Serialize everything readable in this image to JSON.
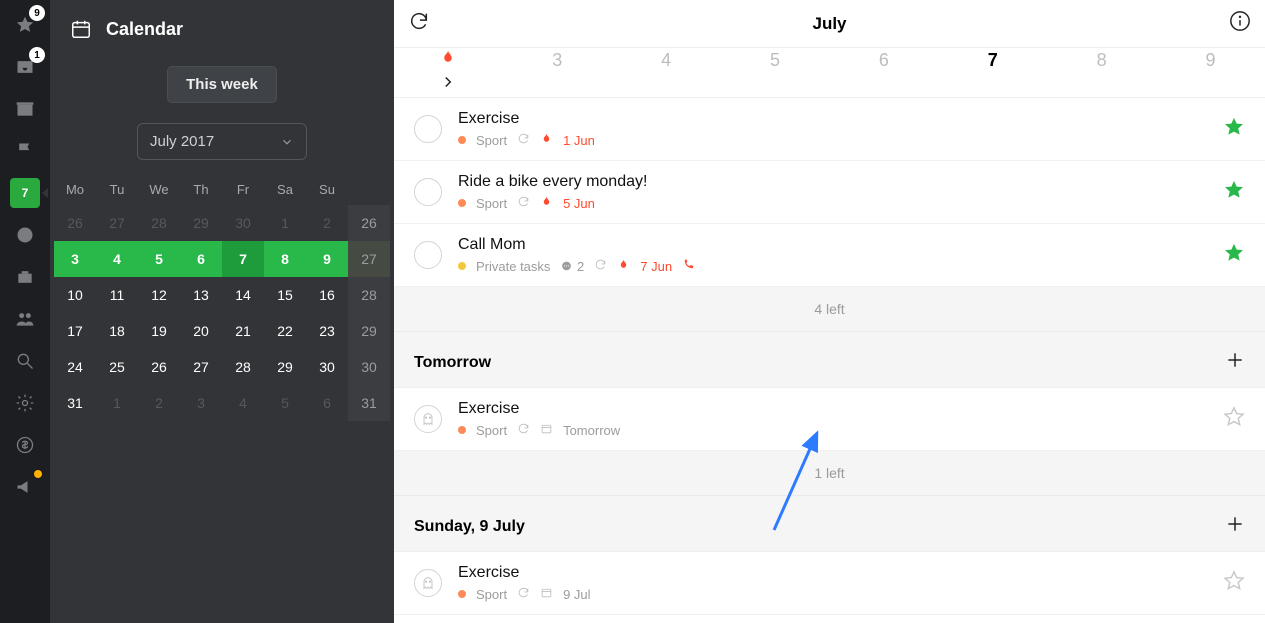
{
  "icon_badges": {
    "star": "9",
    "inbox": "1",
    "cal": "7"
  },
  "sidebar": {
    "title": "Calendar",
    "this_week": "This week",
    "month_label": "July 2017"
  },
  "cal_head": [
    "Mo",
    "Tu",
    "We",
    "Th",
    "Fr",
    "Sa",
    "Su",
    ""
  ],
  "cal_rows": [
    [
      {
        "n": "26",
        "c": "muted"
      },
      {
        "n": "27",
        "c": "muted"
      },
      {
        "n": "28",
        "c": "muted"
      },
      {
        "n": "29",
        "c": "muted"
      },
      {
        "n": "30",
        "c": "muted"
      },
      {
        "n": "1",
        "c": "muted"
      },
      {
        "n": "2",
        "c": "muted"
      },
      {
        "n": "26",
        "c": "wk"
      }
    ],
    [
      {
        "n": "3",
        "c": "green"
      },
      {
        "n": "4",
        "c": "green"
      },
      {
        "n": "5",
        "c": "green"
      },
      {
        "n": "6",
        "c": "green"
      },
      {
        "n": "7",
        "c": "today"
      },
      {
        "n": "8",
        "c": "green"
      },
      {
        "n": "9",
        "c": "green"
      },
      {
        "n": "27",
        "c": "wk green-adj"
      }
    ],
    [
      {
        "n": "10"
      },
      {
        "n": "11"
      },
      {
        "n": "12"
      },
      {
        "n": "13"
      },
      {
        "n": "14"
      },
      {
        "n": "15"
      },
      {
        "n": "16"
      },
      {
        "n": "28",
        "c": "wk"
      }
    ],
    [
      {
        "n": "17"
      },
      {
        "n": "18"
      },
      {
        "n": "19"
      },
      {
        "n": "20"
      },
      {
        "n": "21"
      },
      {
        "n": "22"
      },
      {
        "n": "23"
      },
      {
        "n": "29",
        "c": "wk"
      }
    ],
    [
      {
        "n": "24"
      },
      {
        "n": "25"
      },
      {
        "n": "26"
      },
      {
        "n": "27"
      },
      {
        "n": "28"
      },
      {
        "n": "29"
      },
      {
        "n": "30"
      },
      {
        "n": "30",
        "c": "wk"
      }
    ],
    [
      {
        "n": "31"
      },
      {
        "n": "1",
        "c": "muted"
      },
      {
        "n": "2",
        "c": "muted"
      },
      {
        "n": "3",
        "c": "muted"
      },
      {
        "n": "4",
        "c": "muted"
      },
      {
        "n": "5",
        "c": "muted"
      },
      {
        "n": "6",
        "c": "muted"
      },
      {
        "n": "31",
        "c": "wk"
      }
    ]
  ],
  "topbar": {
    "title": "July"
  },
  "daybar": [
    "fire",
    "3",
    "4",
    "5",
    "6",
    "7",
    "8",
    "9"
  ],
  "daybar_active_idx": 5,
  "tag_colors": {
    "sport": "#ff8a57",
    "private": "#f5c83b"
  },
  "sections": {
    "overdue": {
      "tasks": [
        {
          "title": "Exercise",
          "tag": "Sport",
          "tag_color": "sport",
          "repeat": true,
          "fire": true,
          "due": "1 Jun",
          "starred": true,
          "comment_count": null,
          "phone": false,
          "ghost": false,
          "due_calendar": false
        },
        {
          "title": "Ride a bike every monday!",
          "tag": "Sport",
          "tag_color": "sport",
          "repeat": true,
          "fire": true,
          "due": "5 Jun",
          "starred": true,
          "comment_count": null,
          "phone": false,
          "ghost": false,
          "due_calendar": false
        },
        {
          "title": "Call Mom",
          "tag": "Private tasks",
          "tag_color": "private",
          "repeat": true,
          "fire": true,
          "due": "7 Jun",
          "starred": true,
          "comment_count": "2",
          "phone": true,
          "ghost": false,
          "due_calendar": false
        }
      ],
      "left": "4 left"
    },
    "tomorrow": {
      "label": "Tomorrow",
      "tasks": [
        {
          "title": "Exercise",
          "tag": "Sport",
          "tag_color": "sport",
          "repeat": true,
          "fire": false,
          "due": "Tomorrow",
          "starred": false,
          "comment_count": null,
          "phone": false,
          "ghost": true,
          "due_calendar": true
        }
      ],
      "left": "1 left"
    },
    "sunday": {
      "label": "Sunday, 9 July",
      "tasks": [
        {
          "title": "Exercise",
          "tag": "Sport",
          "tag_color": "sport",
          "repeat": true,
          "fire": false,
          "due": "9 Jul",
          "starred": false,
          "comment_count": null,
          "phone": false,
          "ghost": true,
          "due_calendar": true
        }
      ]
    }
  }
}
